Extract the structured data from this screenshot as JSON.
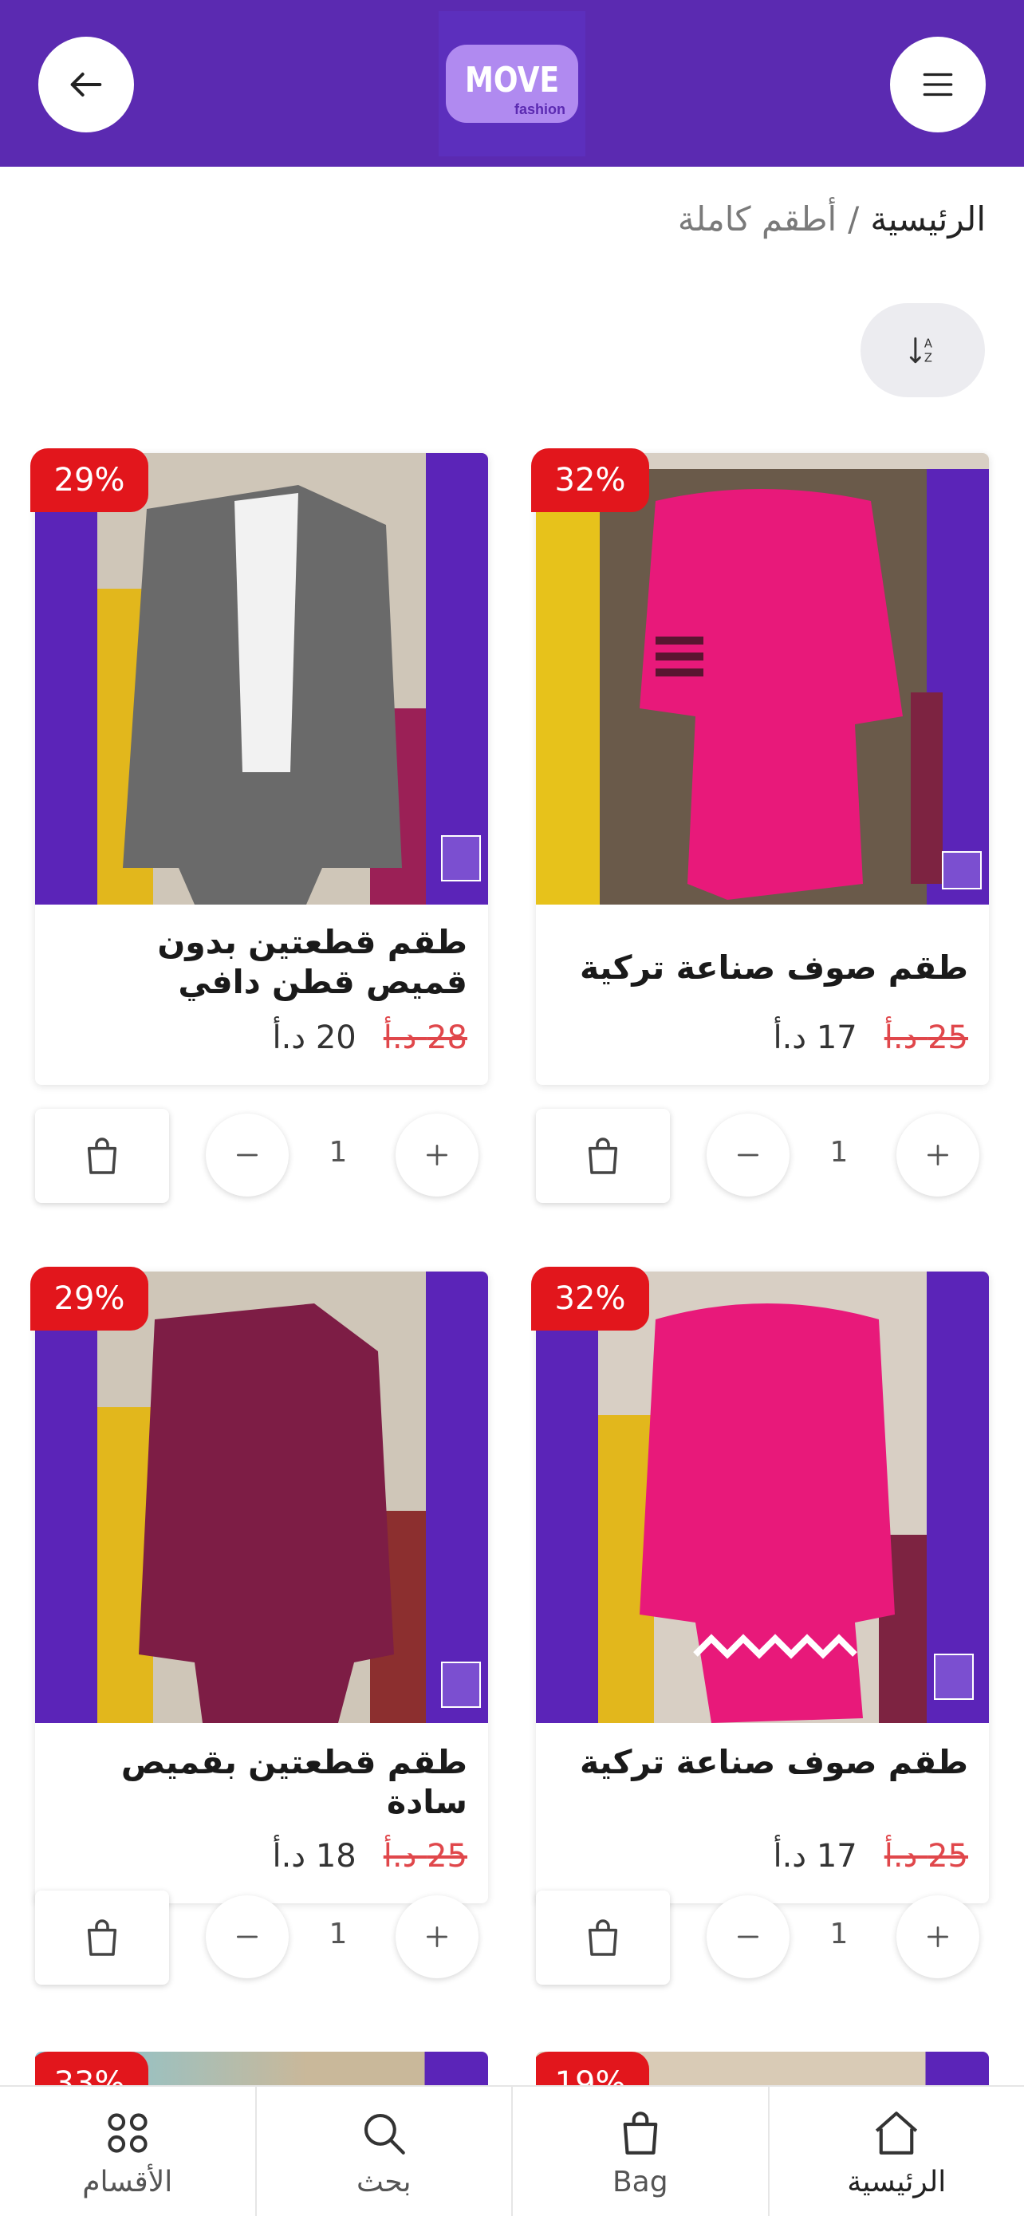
{
  "header": {
    "back_icon": "arrow-left-icon",
    "menu_icon": "hamburger-menu-icon",
    "logo_text": "MOVE",
    "logo_subtext": "fashion",
    "brand_color": "#5b2ab1"
  },
  "breadcrumb": {
    "home": "الرئيسية",
    "separator": "/",
    "current": "أطقم كاملة"
  },
  "sort": {
    "icon": "sort-a-z-icon"
  },
  "products": [
    {
      "discount": "32%",
      "name": "طقم صوف صناعة تركية",
      "old_price": "25 د.أ",
      "price": "17 د.أ",
      "qty": "1",
      "image_colors": [
        "#e8197a",
        "#5b24b8"
      ]
    },
    {
      "discount": "29%",
      "name": "طقم قطعتين بدون قميص قطن دافي",
      "old_price": "28 د.أ",
      "price": "20 د.أ",
      "qty": "1",
      "image_colors": [
        "#6c6c6c",
        "#5b24b8"
      ]
    },
    {
      "discount": "32%",
      "name": "طقم صوف صناعة تركية",
      "old_price": "25 د.أ",
      "price": "17 د.أ",
      "qty": "1",
      "image_colors": [
        "#e8197a",
        "#5b24b8"
      ]
    },
    {
      "discount": "29%",
      "name": "طقم قطعتين بقميص سادة",
      "old_price": "25 د.أ",
      "price": "18 د.أ",
      "qty": "1",
      "image_colors": [
        "#7d1d45",
        "#5b24b8"
      ]
    }
  ],
  "peek_badges": {
    "left": "33%",
    "right": "19%"
  },
  "bottom_nav": {
    "home": "الرئيسية",
    "bag": "Bag",
    "search": "بحث",
    "categories": "الأقسام"
  },
  "colors": {
    "discount_badge": "#e2161c",
    "old_price": "#e0474b"
  }
}
